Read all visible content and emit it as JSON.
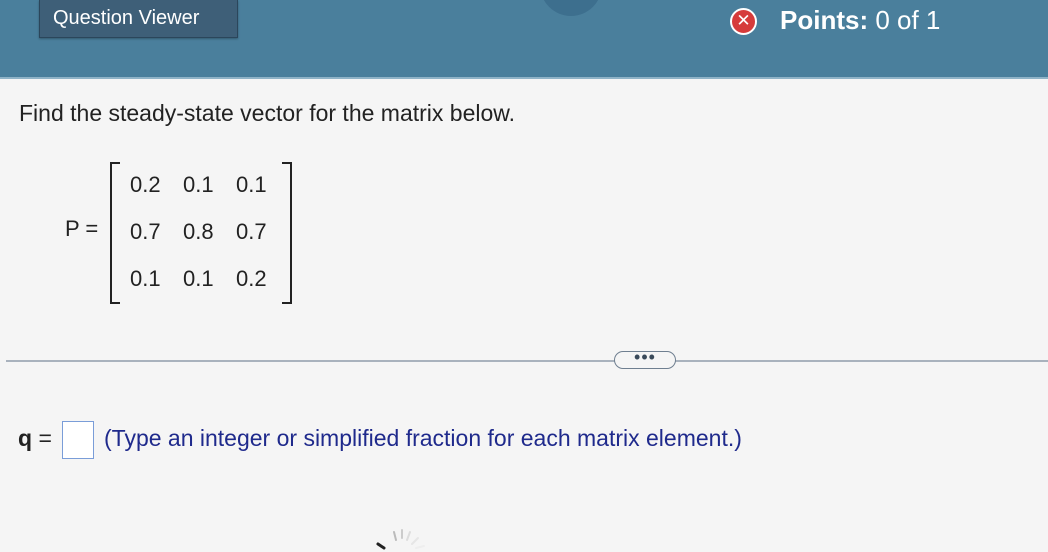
{
  "header": {
    "question_viewer_label": "Question Viewer",
    "points_label": "Points:",
    "points_value": "0 of 1",
    "status_icon": "incorrect-x-icon",
    "colors": {
      "header_bg": "#4a7f9c",
      "button_bg": "#3e5f78",
      "status_red": "#d63b3b"
    }
  },
  "question": {
    "prompt": "Find the steady-state vector for the matrix below.",
    "matrix_label": "P =",
    "matrix": [
      [
        "0.2",
        "0.1",
        "0.1"
      ],
      [
        "0.7",
        "0.8",
        "0.7"
      ],
      [
        "0.1",
        "0.1",
        "0.2"
      ]
    ]
  },
  "divider": {
    "more_label": "•••"
  },
  "answer": {
    "variable": "q",
    "equals": "=",
    "input_value": "",
    "hint": "(Type an integer or simplified fraction for each matrix element.)",
    "hint_color": "#1f2a8c"
  }
}
